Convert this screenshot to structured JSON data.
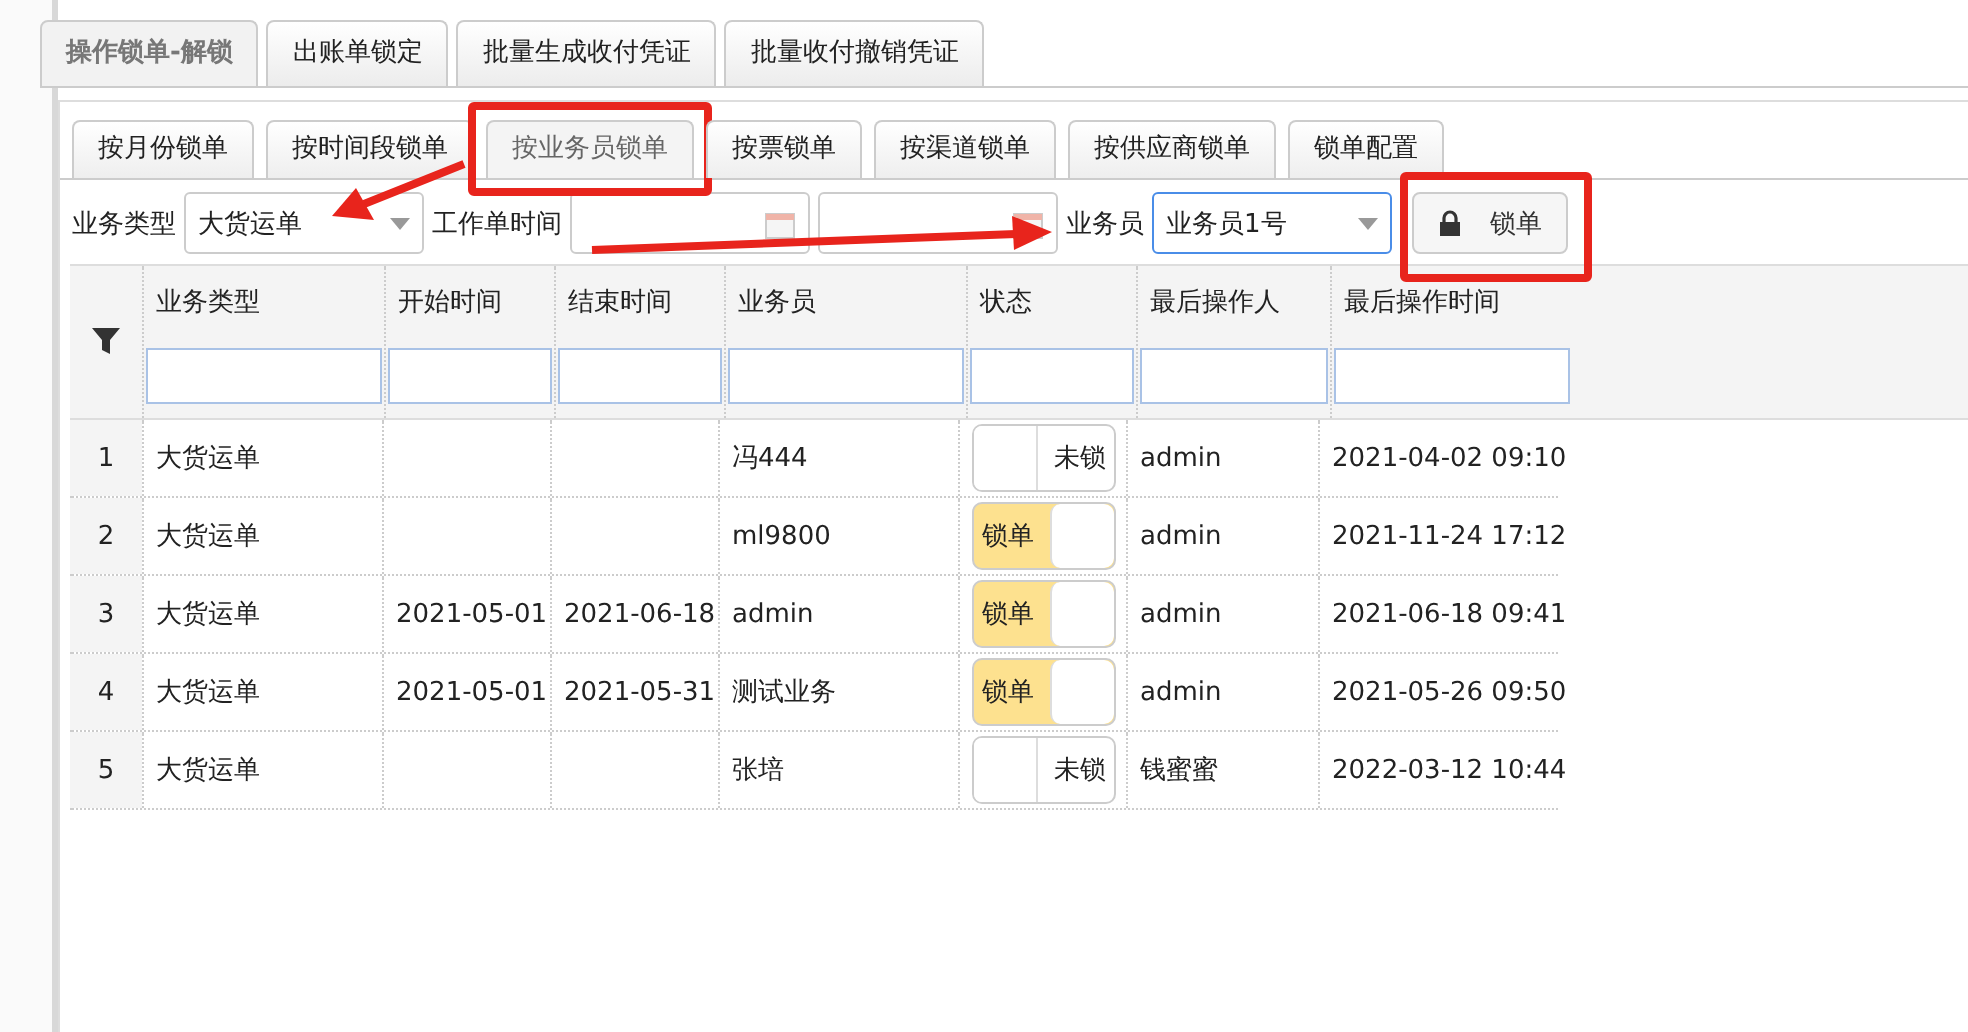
{
  "outer_tabs": [
    {
      "label": "操作锁单-解锁",
      "selected": true
    },
    {
      "label": "出账单锁定",
      "selected": false
    },
    {
      "label": "批量生成收付凭证",
      "selected": false
    },
    {
      "label": "批量收付撤销凭证",
      "selected": false
    }
  ],
  "inner_tabs": [
    {
      "label": "按月份锁单",
      "selected": false
    },
    {
      "label": "按时间段锁单",
      "selected": false
    },
    {
      "label": "按业务员锁单",
      "selected": true
    },
    {
      "label": "按票锁单",
      "selected": false
    },
    {
      "label": "按渠道锁单",
      "selected": false
    },
    {
      "label": "按供应商锁单",
      "selected": false
    },
    {
      "label": "锁单配置",
      "selected": false
    }
  ],
  "toolbar": {
    "type_label": "业务类型",
    "type_value": "大货运单",
    "time_label": "工作单时间",
    "staff_label": "业务员",
    "staff_value": "业务员1号",
    "lock_button": "锁单"
  },
  "table": {
    "columns": [
      "业务类型",
      "开始时间",
      "结束时间",
      "业务员",
      "状态",
      "最后操作人",
      "最后操作时间"
    ],
    "rows": [
      {
        "index": "1",
        "type": "大货运单",
        "start": "",
        "end": "",
        "staff": "冯444",
        "locked": false,
        "status": "未锁",
        "operator": "admin",
        "time": "2021-04-02 09:10"
      },
      {
        "index": "2",
        "type": "大货运单",
        "start": "",
        "end": "",
        "staff": "ml9800",
        "locked": true,
        "status": "锁单",
        "operator": "admin",
        "time": "2021-11-24 17:12"
      },
      {
        "index": "3",
        "type": "大货运单",
        "start": "2021-05-01",
        "end": "2021-06-18",
        "staff": "admin",
        "locked": true,
        "status": "锁单",
        "operator": "admin",
        "time": "2021-06-18 09:41"
      },
      {
        "index": "4",
        "type": "大货运单",
        "start": "2021-05-01",
        "end": "2021-05-31",
        "staff": "测试业务",
        "locked": true,
        "status": "锁单",
        "operator": "admin",
        "time": "2021-05-26 09:50"
      },
      {
        "index": "5",
        "type": "大货运单",
        "start": "",
        "end": "",
        "staff": "张培",
        "locked": false,
        "status": "未锁",
        "operator": "钱蜜蜜",
        "time": "2022-03-12 10:44"
      }
    ]
  }
}
